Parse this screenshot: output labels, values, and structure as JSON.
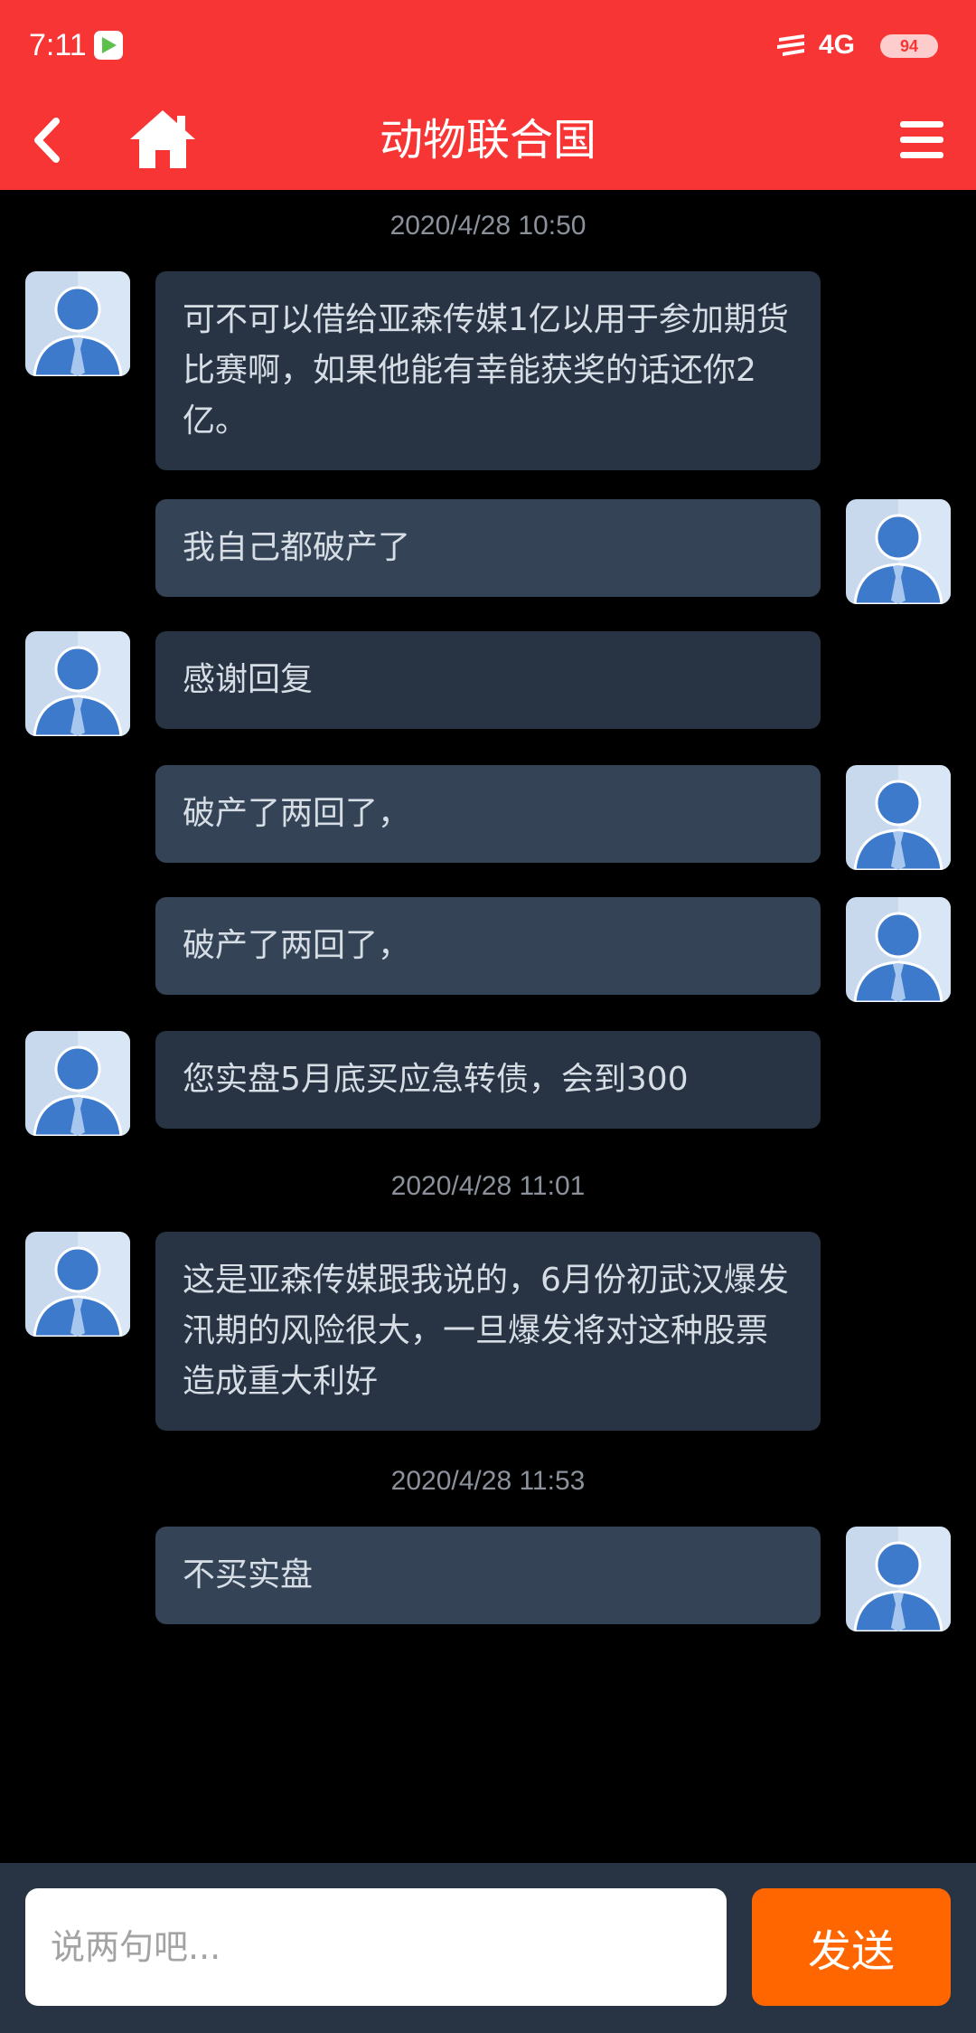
{
  "status_bar": {
    "time": "7:11",
    "network": "4G",
    "battery": "94"
  },
  "header": {
    "title": "动物联合国",
    "back_icon": "chevron-left-icon",
    "home_icon": "home-icon",
    "menu_icon": "hamburger-menu-icon"
  },
  "timestamps": [
    "2020/4/28 10:50",
    "2020/4/28 11:01",
    "2020/4/28 11:53"
  ],
  "messages": [
    {
      "side": "received",
      "text": "可不可以借给亚森传媒1亿以用于参加期货比赛啊，如果他能有幸能获奖的话还你2亿。"
    },
    {
      "side": "sent",
      "text": "我自己都破产了"
    },
    {
      "side": "received",
      "text": "感谢回复"
    },
    {
      "side": "sent",
      "text": "破产了两回了，"
    },
    {
      "side": "sent",
      "text": "破产了两回了，"
    },
    {
      "side": "received",
      "text": "您实盘5月底买应急转债，会到300"
    },
    {
      "side": "received",
      "text": "这是亚森传媒跟我说的，6月份初武汉爆发汛期的风险很大，一旦爆发将对这种股票造成重大利好"
    },
    {
      "side": "sent",
      "text": "不买实盘"
    }
  ],
  "input": {
    "placeholder": "说两句吧...",
    "value": ""
  },
  "send_button": {
    "label": "发送"
  },
  "colors": {
    "header": "#f83535",
    "send_button": "#ff6600",
    "received_bubble": "#283444",
    "sent_bubble": "#344456"
  }
}
